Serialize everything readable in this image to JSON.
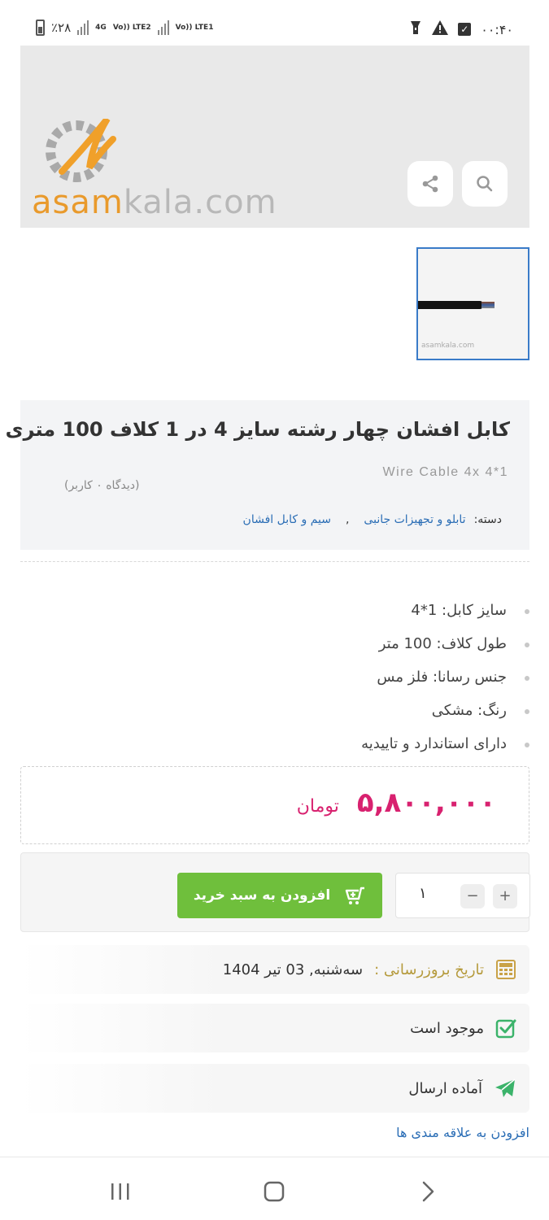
{
  "status_bar": {
    "time": "۰۰:۴۰",
    "battery": "٪۲۸",
    "network_1": "4G",
    "network_2": "Vo)) LTE2",
    "network_3": "Vo)) LTE1"
  },
  "hero": {
    "logo_text_prefix": "asam",
    "logo_text_suffix": "kala.com",
    "share_icon": "share-icon",
    "search_icon": "search-icon"
  },
  "thumbnail": {
    "logo_text": "asamkala.com"
  },
  "product": {
    "title": "کابل افشان چهار رشته سایز 4 در 1 کلاف 100 متری",
    "subtitle": "Wire Cable 4x 4*1",
    "views": "(دیدگاه ۰ کاربر)",
    "category_label": "دسته:",
    "categories": [
      "تابلو و تجهیزات جانبی",
      "سیم و کابل افشان"
    ],
    "category_separator": ","
  },
  "specs": [
    "سایز کابل: 1*4",
    "طول کلاف: 100 متر",
    "جنس رسانا: فلز مس",
    "رنگ: مشکی",
    "دارای استاندارد و تاییدیه"
  ],
  "price": {
    "value": "۵,۸۰۰,۰۰۰",
    "currency": "تومان"
  },
  "cart": {
    "quantity": "۱",
    "minus": "−",
    "plus": "+",
    "add_label": "افزودن به سبد خرید"
  },
  "info": {
    "update_label": "تاریخ بروزرسانی :",
    "update_value": "سه‌شنبه, 03 تیر 1404",
    "stock": "موجود است",
    "shipping": "آماده ارسال",
    "wishlist": "افزودن به علاقه مندی ها"
  },
  "colors": {
    "accent_green": "#6fbf3c",
    "price_pink": "#d8216f",
    "link_blue": "#2a6db5"
  }
}
